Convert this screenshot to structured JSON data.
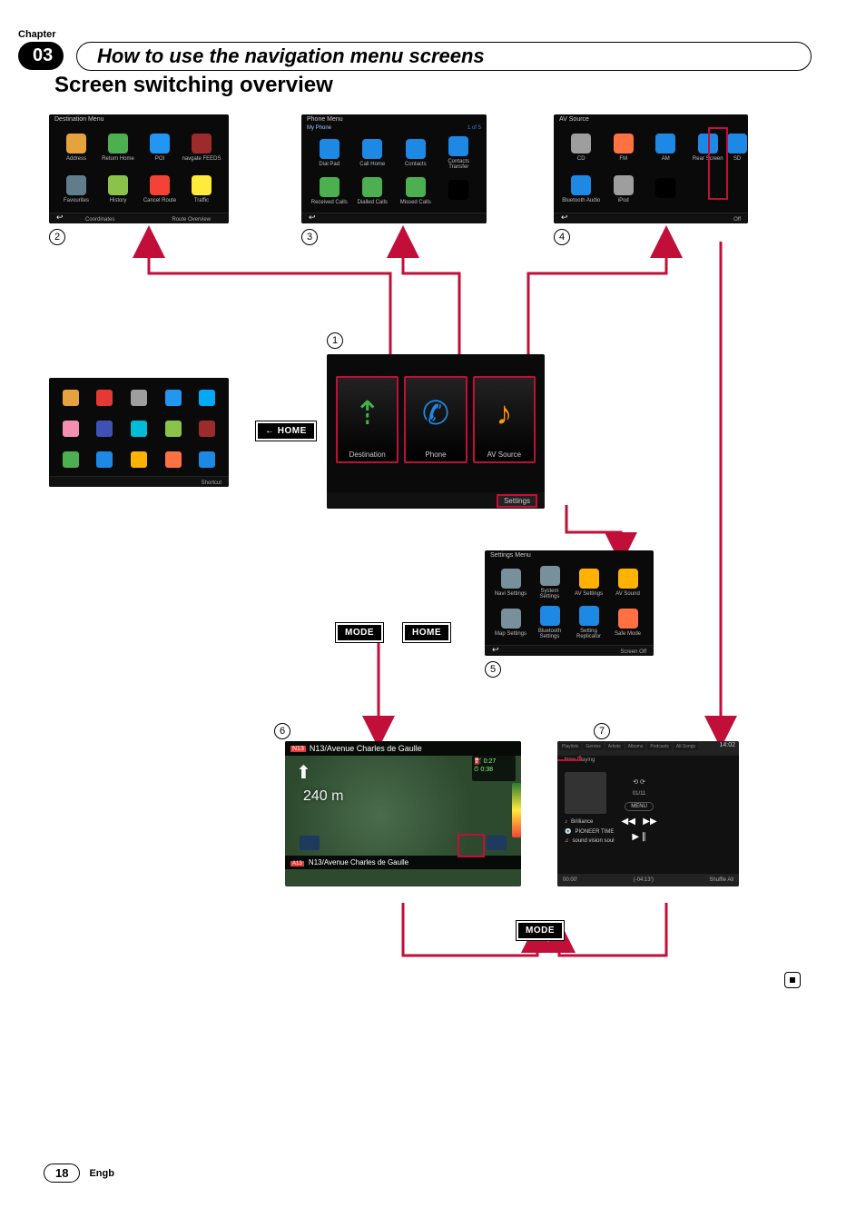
{
  "header": {
    "chapter_word": "Chapter",
    "chapter_num": "03",
    "chapter_title": "How to use the navigation menu screens"
  },
  "section_title": "Screen switching overview",
  "labels": {
    "n1": "1",
    "n2": "2",
    "n3": "3",
    "n4": "4",
    "n5": "5",
    "n6": "6",
    "n7": "7"
  },
  "buttons": {
    "home": "HOME",
    "mode": "MODE"
  },
  "shots": {
    "destination": {
      "title": "Destination Menu",
      "items": [
        "Address",
        "Return Home",
        "POI",
        "navgate FEEDS",
        "Favourites",
        "History",
        "Cancel Route",
        "Traffic"
      ],
      "strip": [
        "Coordinates",
        "Route Overview"
      ]
    },
    "phone": {
      "title": "Phone Menu",
      "sub_left": "My Phone",
      "sub_right_status": "1 of 5",
      "items": [
        "Dial Pad",
        "Call Home",
        "Contacts",
        "Contacts Transfer",
        "Received Calls",
        "Dialled Calls",
        "Missed Calls",
        ""
      ]
    },
    "av": {
      "title": "AV Source",
      "items": [
        "CD",
        "FM",
        "AM",
        "Rear Screen",
        "SD",
        "Bluetooth Audio",
        "iPod",
        ""
      ],
      "off": "Off"
    },
    "home": {
      "tiles": [
        "Destination",
        "Phone",
        "AV Source"
      ],
      "settings": "Settings"
    },
    "shortcut": {
      "bottom": "Shortcut"
    },
    "settings_menu": {
      "title": "Settings Menu",
      "items": [
        "Navi Settings",
        "System Settings",
        "AV Settings",
        "AV Sound",
        "Map Settings",
        "Bluetooth Settings",
        "Setting Replicator",
        "Safe Mode"
      ],
      "strip_right": "Screen Off"
    },
    "map": {
      "top_badge": "N13",
      "top_text": "N13/Avenue Charles de Gaulle",
      "dist": "240 m",
      "bottom_badge": "A13",
      "bottom_text": "N13/Avenue Charles de Gaulle",
      "time_top": "0:27",
      "time_bot": "0:38"
    },
    "media": {
      "clock": "14:02",
      "tabs": [
        "Playlists",
        "Genres",
        "Artists",
        "Albums",
        "Podcasts",
        "All Songs"
      ],
      "now": "Now Playing",
      "track_pos": "01/11",
      "menu_btn": "MENU",
      "artist": "Brilliance",
      "album": "PIONEER TIME",
      "song": "sound vision soul",
      "elapsed": "00:00'",
      "total": "(-04:13')",
      "shuffle": "Shuffle All"
    }
  },
  "footer": {
    "page": "18",
    "lang": "Engb"
  }
}
